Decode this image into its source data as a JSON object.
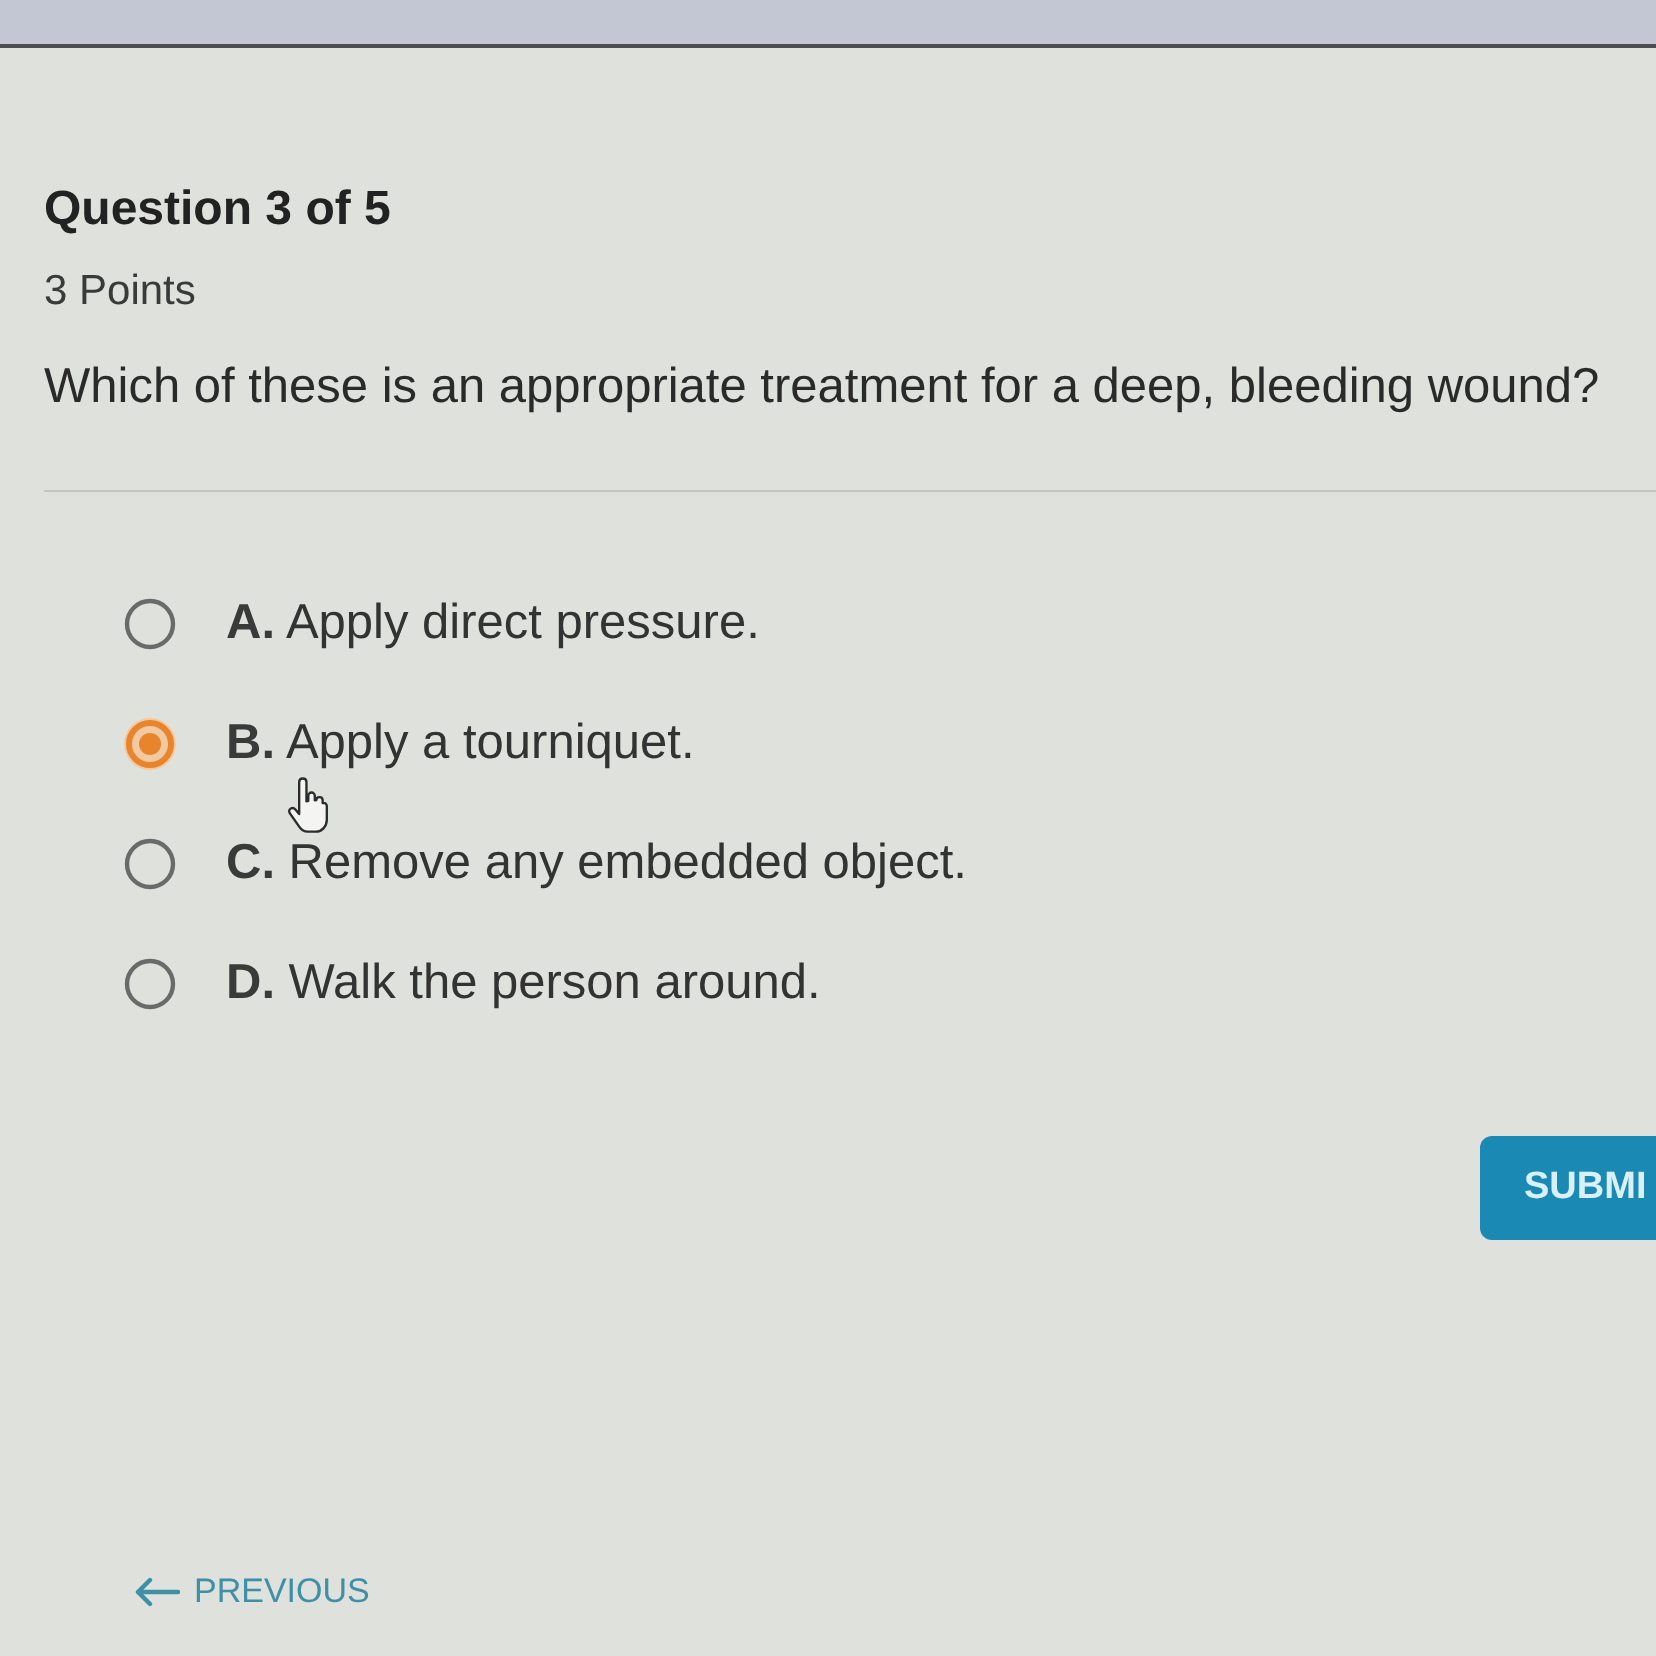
{
  "question": {
    "title": "Question 3 of 5",
    "points": "3 Points",
    "prompt": "Which of these is an appropriate treatment for a deep, bleeding wound?"
  },
  "options": [
    {
      "label": "**A.** Apply direct pressure.",
      "selected": false
    },
    {
      "label": "**B.** Apply a tourniquet.",
      "selected": true
    },
    {
      "label": "**C.** Remove any embedded object.",
      "selected": false
    },
    {
      "label": "**D.** Walk the person around.",
      "selected": false
    }
  ],
  "submit_button": "SUBMI",
  "previous_link": "PREVIOUS"
}
